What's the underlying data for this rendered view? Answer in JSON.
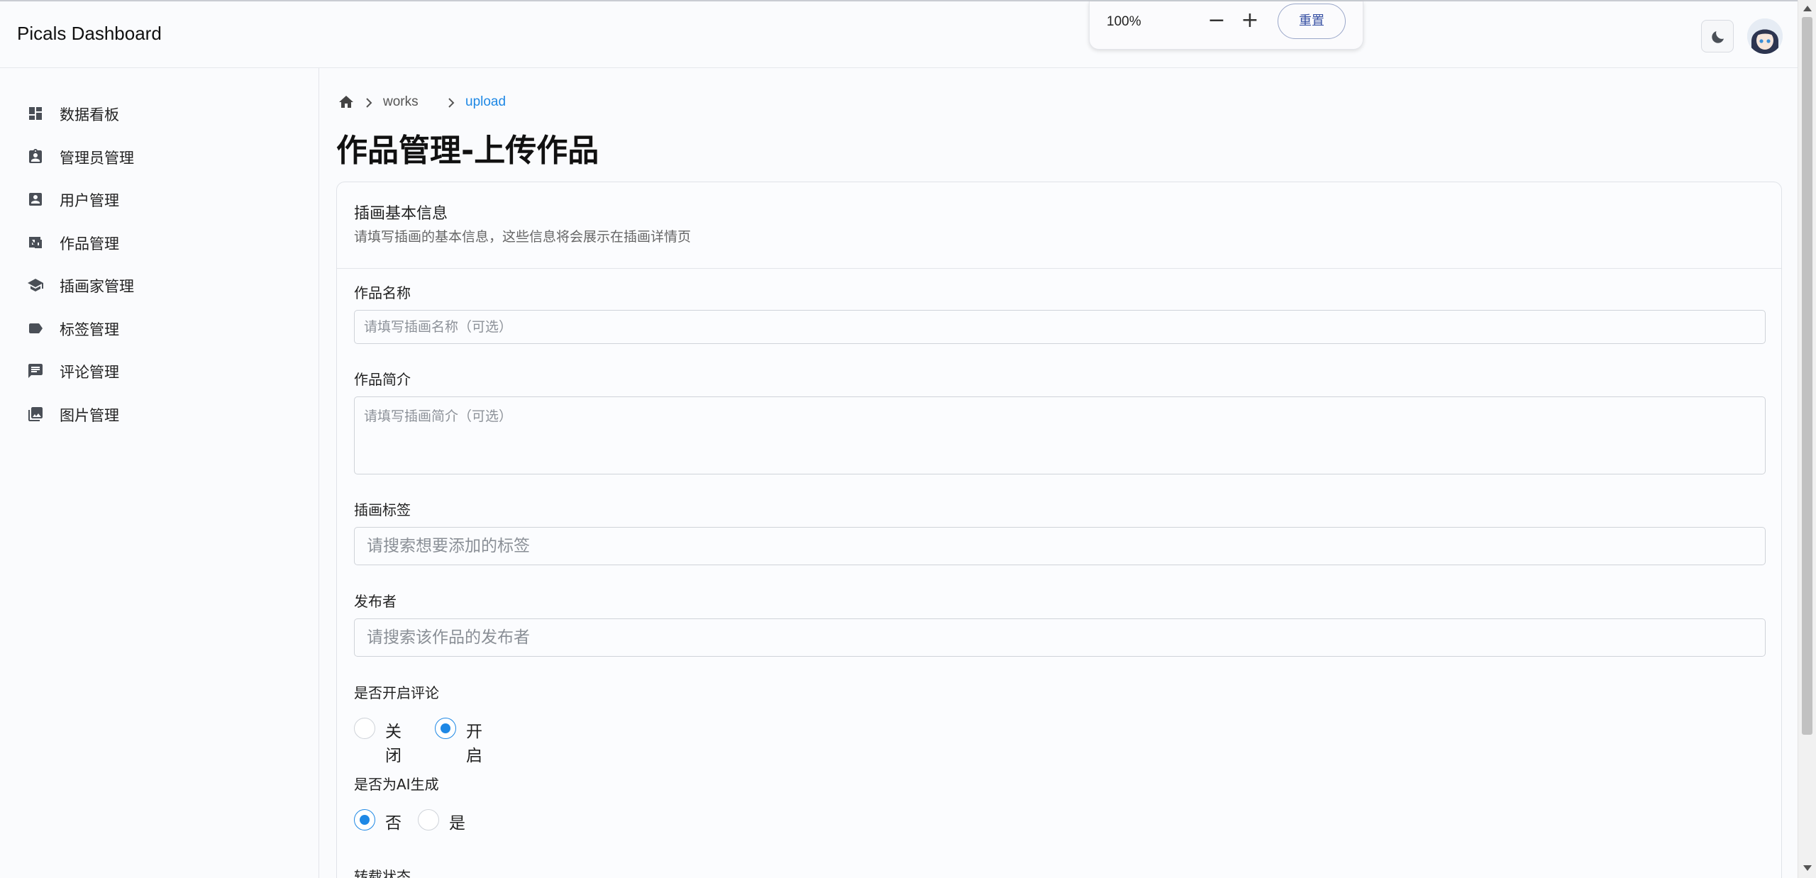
{
  "app": {
    "title": "Picals Dashboard"
  },
  "zoom": {
    "level": "100%",
    "minus": "−",
    "plus": "+",
    "reset": "重置"
  },
  "sidebar": {
    "items": [
      {
        "label": "数据看板",
        "icon": "dashboard-icon"
      },
      {
        "label": "管理员管理",
        "icon": "admin-badge-icon"
      },
      {
        "label": "用户管理",
        "icon": "user-card-icon"
      },
      {
        "label": "作品管理",
        "icon": "works-icon"
      },
      {
        "label": "插画家管理",
        "icon": "graduation-cap-icon"
      },
      {
        "label": "标签管理",
        "icon": "tag-icon"
      },
      {
        "label": "评论管理",
        "icon": "comment-icon"
      },
      {
        "label": "图片管理",
        "icon": "photo-library-icon"
      }
    ]
  },
  "breadcrumb": {
    "items": [
      "works",
      "upload"
    ]
  },
  "page": {
    "title": "作品管理-上传作品"
  },
  "card": {
    "title": "插画基本信息",
    "subtitle": "请填写插画的基本信息，这些信息将会展示在插画详情页"
  },
  "form": {
    "name": {
      "label": "作品名称",
      "placeholder": "请填写插画名称（可选）"
    },
    "intro": {
      "label": "作品简介",
      "placeholder": "请填写插画简介（可选）"
    },
    "tags": {
      "label": "插画标签",
      "placeholder": "请搜索想要添加的标签"
    },
    "publisher": {
      "label": "发布者",
      "placeholder": "请搜索该作品的发布者"
    },
    "comments": {
      "label": "是否开启评论",
      "options": [
        "关闭",
        "开启"
      ],
      "selected": "开启"
    },
    "ai": {
      "label": "是否为AI生成",
      "options": [
        "否",
        "是"
      ],
      "selected": "否"
    },
    "reprint": {
      "label": "转载状态"
    }
  },
  "colors": {
    "accent": "#1e88e5",
    "link": "#1e88e5"
  }
}
